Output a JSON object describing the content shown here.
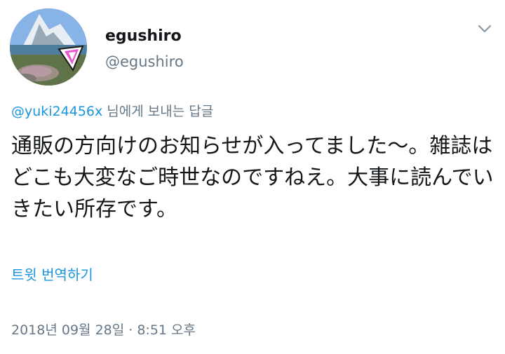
{
  "user": {
    "display_name": "egushiro",
    "handle": "@egushiro",
    "avatar_icon": "mountain-landscape-avatar"
  },
  "menu": {
    "icon": "chevron-down-icon"
  },
  "reply": {
    "mention": "@yuki24456x",
    "suffix": " 님에게 보내는 답글"
  },
  "tweet": {
    "text": "通販の方向けのお知らせが入ってました〜。雑誌はどこも大変なご時世なのですねえ。大事に読んでいきたい所存です。"
  },
  "actions": {
    "translate_label": "트윗 번역하기"
  },
  "meta": {
    "timestamp": "2018년 09월 28일 · 8:51 오후"
  },
  "colors": {
    "link_blue": "#1b95e0",
    "secondary_gray": "#657786",
    "text_primary": "#14171a"
  }
}
